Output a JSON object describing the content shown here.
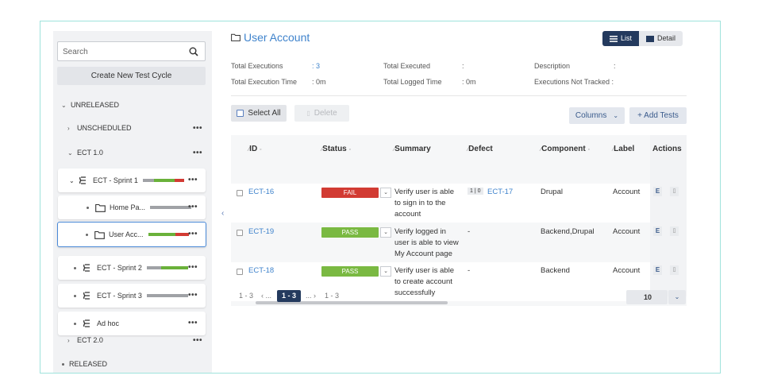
{
  "colors": {
    "accent": "#3f83cc",
    "fail": "#d23b33",
    "pass": "#7ab942",
    "dark": "#243a5e",
    "bar_gray": "#a0a2a6",
    "bar_green": "#6ab13a",
    "bar_red": "#d23b33"
  },
  "sidebar": {
    "search_placeholder": "Search",
    "create_label": "Create New Test Cycle",
    "unreleased": "UNRELEASED",
    "unscheduled": "UNSCHEDULED",
    "ect10": "ECT 1.0",
    "sprint1": "ECT - Sprint 1",
    "home_page": "Home Pa...",
    "user_account": "User Acc...",
    "sprint2": "ECT - Sprint 2",
    "sprint3": "ECT - Sprint 3",
    "adhoc": "Ad hoc",
    "ect20": "ECT 2.0",
    "released": "RELEASED",
    "more": "•••"
  },
  "header": {
    "title": "User Account",
    "list_label": "List",
    "detail_label": "Detail"
  },
  "meta": {
    "total_executions_label": "Total Executions",
    "total_executions_value": ": 3",
    "total_execution_time_label": "Total Execution Time",
    "total_execution_time_value": ": 0m",
    "total_executed_label": "Total Executed",
    "total_executed_value": ":",
    "total_logged_time_label": "Total Logged Time",
    "total_logged_time_value": ": 0m",
    "description_label": "Description",
    "description_value": ":",
    "executions_not_tracked_label": "Executions Not Tracked :"
  },
  "toolbar": {
    "select_all": "Select All",
    "delete": "Delete",
    "columns": "Columns",
    "add_tests": "+ Add Tests"
  },
  "table": {
    "headers": {
      "id": "ID",
      "status": "Status",
      "summary": "Summary",
      "defect": "Defect",
      "component": "Component",
      "label": "Label",
      "actions": "Actions"
    },
    "rows": [
      {
        "id": "ECT-16",
        "status": "FAIL",
        "summary": [
          "Verify user is able",
          "to sign in to the",
          "account"
        ],
        "defect_badge": "1 | 0",
        "defect": "ECT-17",
        "component": "Drupal",
        "label": "Account",
        "edit": "E"
      },
      {
        "id": "ECT-19",
        "status": "PASS",
        "summary": [
          "Verify logged in",
          "user is able to view",
          "My Account page"
        ],
        "defect_badge": "",
        "defect": "-",
        "component": "Backend,Drupal",
        "label": "Account",
        "edit": "E"
      },
      {
        "id": "ECT-18",
        "status": "PASS",
        "summary": [
          "Verify user is able",
          "to create account",
          "successfully"
        ],
        "defect_badge": "",
        "defect": "-",
        "component": "Backend",
        "label": "Account",
        "edit": "E"
      }
    ]
  },
  "pager": {
    "left_range": "1 - 3",
    "prev": "‹ ...",
    "current": "1 - 3",
    "next": "... ›",
    "right_range": "1 - 3",
    "page_size": "10"
  }
}
